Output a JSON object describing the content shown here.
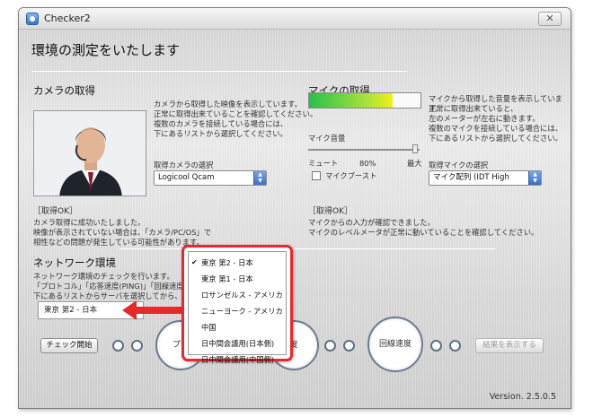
{
  "window": {
    "title": "Checker2",
    "close": "✕"
  },
  "page_title": "環境の測定をいたします",
  "camera": {
    "title": "カメラの取得",
    "desc": [
      "カメラから取得した映像を表示しています。",
      "正常に取得出来ていることを確認してください。",
      "複数のカメラを接続している場合には、",
      "下にあるリストから選択してください。"
    ],
    "select_label": "取得カメラの選択",
    "select_value": "Logicool Qcam",
    "status_title": "［取得OK］",
    "status_lines": [
      "カメラ取得に成功いたしました。",
      "映像が表示されていない場合は、「カメラ/PC/OS」で",
      "相性などの問題が発生している可能性があります。"
    ]
  },
  "mic": {
    "title": "マイクの取得",
    "level": 0.75,
    "desc": [
      "マイクから取得した音量を表示しています。",
      "正常に取得出来ていると、",
      "左のメーターが左右に動きます。",
      "複数のマイクを接続している場合には、",
      "下にあるリストから選択してください。"
    ],
    "volume_label": "マイク音量",
    "mute_label": "ミュート",
    "volume_value": "80%",
    "max_label": "最大",
    "volume_level": 0.8,
    "boost_label": "マイクブースト",
    "select_label": "取得マイクの選択",
    "select_value": "マイク配列 (IDT High",
    "status_title": "［取得OK］",
    "status_lines": [
      "マイクからの入力が確認できました。",
      "マイクのレベルメータが正常に動いていることを確認してください。"
    ]
  },
  "network": {
    "title": "ネットワーク環境",
    "desc": [
      "ネットワーク環境のチェックを行います。",
      "「プロトコル」「応答速度(PING)」「回線速度」の3",
      "下にあるリストからサーバを選択してから、「チェ"
    ],
    "server_value": "東京 第2 - 日本",
    "check_button": "チェック開始",
    "circle_protocol": "プロ",
    "circle_ping": "度",
    "circle_speed": "回線速度",
    "result_button": "結果を表示する",
    "dropdown": [
      {
        "label": "東京 第2 - 日本",
        "checked": true
      },
      {
        "label": "東京 第1 - 日本",
        "checked": false
      },
      {
        "label": "ロサンゼルス - アメリカ",
        "checked": false
      },
      {
        "label": "ニューヨーク - アメリカ",
        "checked": false
      },
      {
        "label": "中国",
        "checked": false
      },
      {
        "label": "日中間会議用(日本側)",
        "checked": false
      },
      {
        "label": "日中間会議用(中国側)",
        "checked": false
      }
    ],
    "check_glyph": "✔"
  },
  "version": "Version. 2.5.0.5",
  "colors": {
    "highlight": "#e6292d",
    "meter_green": "#29c04a",
    "meter_yellow": "#f2ef1c"
  }
}
